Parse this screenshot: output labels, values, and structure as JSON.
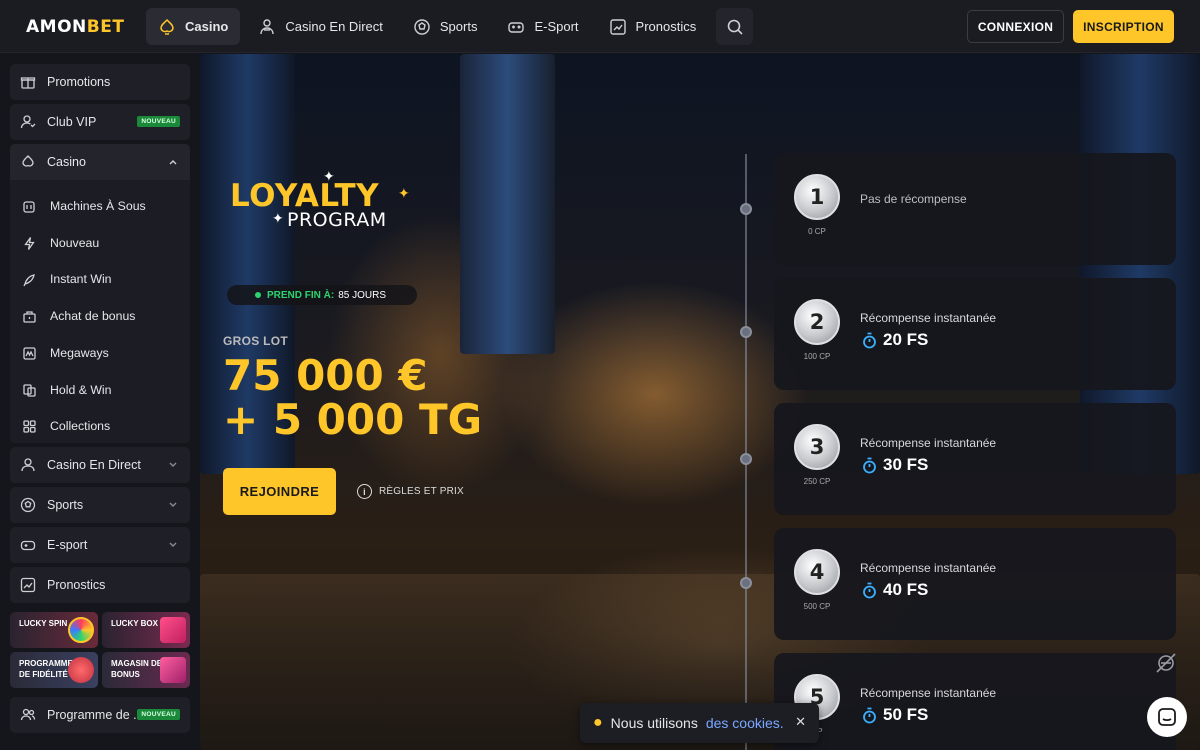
{
  "brand": {
    "logo_main": "AMON",
    "logo_accent": "BET"
  },
  "nav": {
    "items": [
      {
        "label": "Casino",
        "icon": "casino-icon"
      },
      {
        "label": "Casino En Direct",
        "icon": "dealer-icon"
      },
      {
        "label": "Sports",
        "icon": "soccer-ball-icon"
      },
      {
        "label": "E-Sport",
        "icon": "gamepad-icon"
      },
      {
        "label": "Pronostics",
        "icon": "chart-icon"
      }
    ],
    "search_icon": "search-icon"
  },
  "auth": {
    "login": "CONNEXION",
    "signup": "INSCRIPTION"
  },
  "sidebar": {
    "promotions": "Promotions",
    "club_vip": "Club VIP",
    "new_badge": "NOUVEAU",
    "casino": "Casino",
    "casino_sub": [
      "Machines À Sous",
      "Nouveau",
      "Instant Win",
      "Achat de bonus",
      "Megaways",
      "Hold & Win",
      "Collections"
    ],
    "casino_direct": "Casino En Direct",
    "sports": "Sports",
    "esport": "E-sport",
    "pronostics": "Pronostics",
    "tiles": {
      "lucky_spin": "LUCKY SPIN",
      "lucky_box": "LUCKY BOX",
      "fidelity_line1": "PROGRAMME",
      "fidelity_line2": "DE FIDÉLITÉ",
      "shop_line1": "MAGASIN DES",
      "shop_line2": "BONUS"
    },
    "referral": "Programme de ..."
  },
  "hero": {
    "logo_line1": "LOYALTY",
    "logo_line2": "PROGRAM",
    "ends_label": "PREND FIN À:",
    "ends_value": "85 JOURS",
    "jackpot_label": "GROS LOT",
    "jackpot_line1": "75 000 €",
    "jackpot_line2": "+ 5 000 TG",
    "join_button": "REJOINDRE",
    "rules_link": "RÈGLES ET PRIX"
  },
  "levels": [
    {
      "num": "1",
      "cp": "0 CP",
      "title": "Pas de récompense",
      "reward": ""
    },
    {
      "num": "2",
      "cp": "100 CP",
      "title": "Récompense instantanée",
      "reward": "20 FS"
    },
    {
      "num": "3",
      "cp": "250 CP",
      "title": "Récompense instantanée",
      "reward": "30 FS"
    },
    {
      "num": "4",
      "cp": "500 CP",
      "title": "Récompense instantanée",
      "reward": "40 FS"
    },
    {
      "num": "5",
      "cp": "CP",
      "title": "Récompense instantanée",
      "reward": "50 FS"
    }
  ],
  "cookie": {
    "text": "Nous utilisons",
    "link": "des cookies.",
    "close": "✕"
  },
  "colors": {
    "accent": "#ffc629",
    "background": "#15161b",
    "success": "#2dd36f"
  }
}
